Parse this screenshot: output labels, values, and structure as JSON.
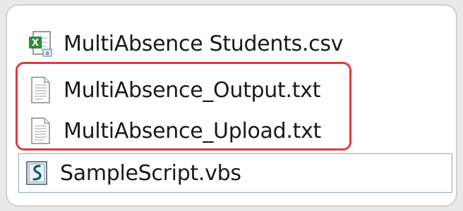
{
  "files": [
    {
      "name": "MultiAbsence Students.csv",
      "icon": "csv-excel-icon"
    },
    {
      "name": "MultiAbsence_Output.txt",
      "icon": "text-file-icon"
    },
    {
      "name": "MultiAbsence_Upload.txt",
      "icon": "text-file-icon"
    },
    {
      "name": "SampleScript.vbs",
      "icon": "vbscript-file-icon"
    }
  ],
  "highlight": {
    "color": "#e03a3a",
    "covers": [
      "MultiAbsence_Output.txt",
      "MultiAbsence_Upload.txt"
    ]
  },
  "selection_border_color": "#8aa8cf"
}
